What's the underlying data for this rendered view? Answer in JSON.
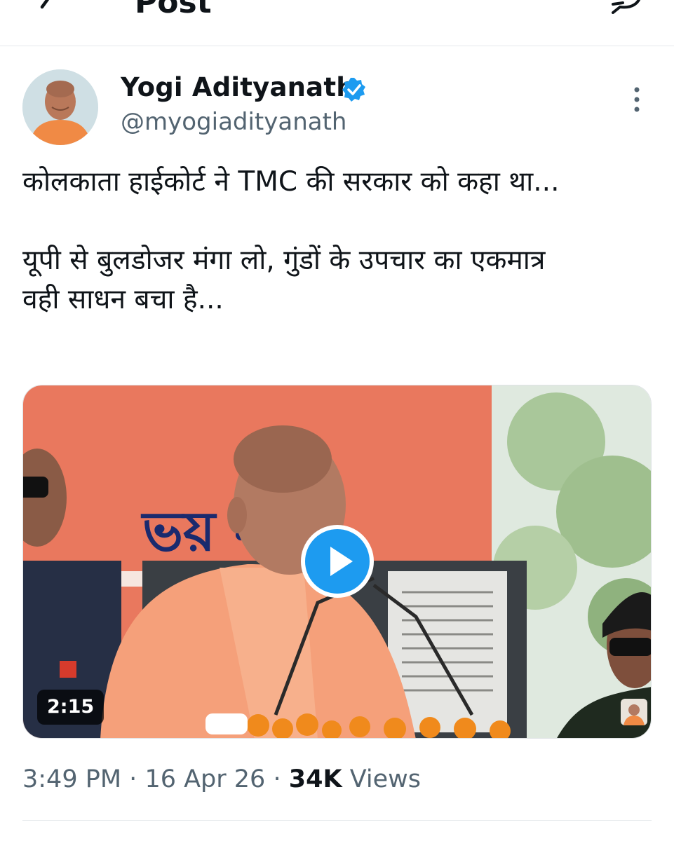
{
  "header": {
    "title": "Post",
    "back_icon": "arrow-left-icon",
    "reply_icon": "reply-icon"
  },
  "tweet": {
    "author": {
      "name": "Yogi Adityanath",
      "handle": "@myogiadityanath",
      "verified": true,
      "verified_color": "#1d9bf0"
    },
    "text_lines": [
      "कोलकाता हाईकोर्ट ने TMC की सरकार को कहा था...",
      "यूपी से बुलडोजर मंगा लो, गुंडों के उपचार का एकमात्र",
      "वही साधन बचा है..."
    ],
    "media": {
      "type": "video",
      "duration": "2:15",
      "play_icon": "play-icon",
      "backdrop_text": "ভয় নয়"
    },
    "meta": {
      "time": "3:49 PM",
      "separator": "·",
      "date": "16 Apr 26",
      "views_count": "34K",
      "views_label": "Views"
    }
  },
  "colors": {
    "accent": "#1d9bf0",
    "secondary_text": "#536471",
    "primary_text": "#0f1419"
  }
}
